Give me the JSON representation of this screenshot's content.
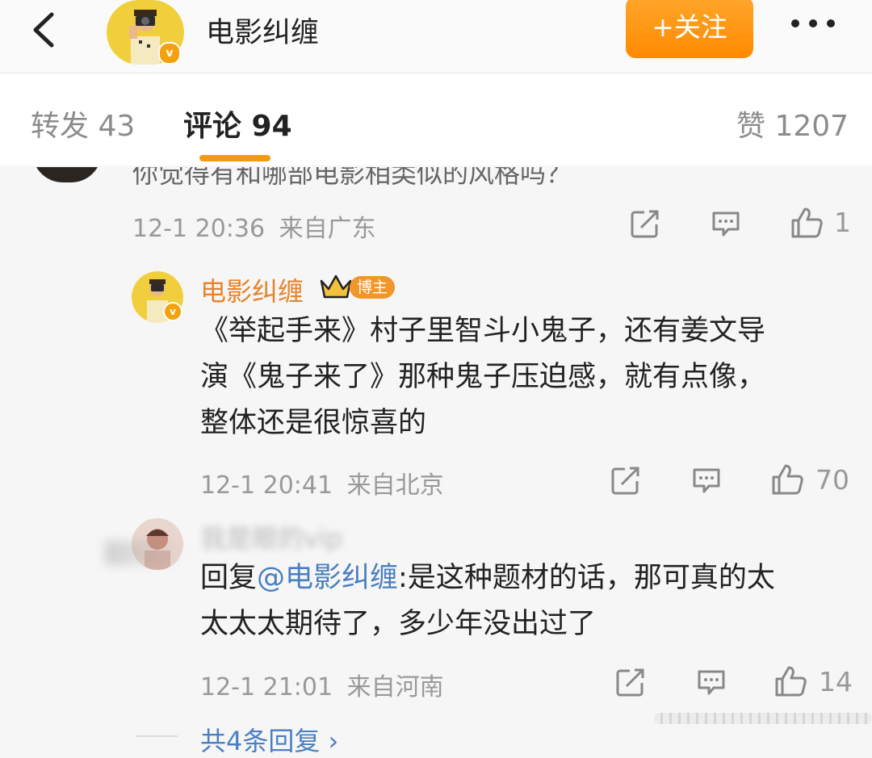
{
  "header": {
    "title": "电影纠缠",
    "follow_label": "+关注",
    "verified_badge": "v"
  },
  "tabs": {
    "repost": "转发 43",
    "comment": "评论 94",
    "like": "赞 1207"
  },
  "colors": {
    "accent": "#f49a12",
    "follow_bg": "#ff9500",
    "name_orange": "#e8832c",
    "mention_blue": "#4a7fc1",
    "meta_gray": "#999999"
  },
  "comments": [
    {
      "text": "你觉得有和哪部电影相类似的风格吗？",
      "time": "12-1 20:36",
      "location": "来自广东",
      "likes": "1"
    },
    {
      "author": "电影纠缠",
      "badge": "博主",
      "lines": [
        "《举起手来》村子里智斗小鬼子，还有姜文导",
        "演《鬼子来了》那种鬼子压迫感，就有点像，",
        "整体还是很惊喜的"
      ],
      "time": "12-1 20:41",
      "location": "来自北京",
      "likes": "70"
    },
    {
      "author": "我是眼的vip",
      "reply_prefix": "回复",
      "mention": "@电影纠缠",
      "line1_rest": ":是这种题材的话，那可真的太",
      "line2": "太太太期待了，多少年没出过了",
      "time": "12-1 21:01",
      "location": "来自河南",
      "likes": "14"
    }
  ],
  "reply_summary": "共4条回复 ›",
  "icons": [
    "back-arrow-icon",
    "more-icon",
    "share-icon",
    "comment-icon",
    "like-icon",
    "crown-icon"
  ]
}
